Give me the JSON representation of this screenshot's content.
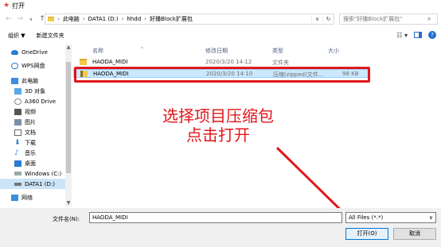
{
  "window": {
    "title": "打开"
  },
  "address": {
    "crumbs": [
      "此电脑",
      "DATA1 (D:)",
      "hhdd",
      "好播Block扩展包"
    ],
    "search_placeholder": "搜索\"好播Block扩展包\""
  },
  "toolbar": {
    "organize": "组织 ▼",
    "new_folder": "新建文件夹"
  },
  "sidebar": {
    "items": [
      {
        "label": "OneDrive",
        "icon": "cloud-icon"
      },
      {
        "label": "WPS网盘",
        "icon": "wps-cloud-icon"
      },
      {
        "label": "此电脑",
        "icon": "computer-icon"
      },
      {
        "label": "3D 对象",
        "icon": "3d-objects-icon"
      },
      {
        "label": "A360 Drive",
        "icon": "a360-icon"
      },
      {
        "label": "视频",
        "icon": "video-icon"
      },
      {
        "label": "图片",
        "icon": "pictures-icon"
      },
      {
        "label": "文档",
        "icon": "documents-icon"
      },
      {
        "label": "下载",
        "icon": "download-icon"
      },
      {
        "label": "音乐",
        "icon": "music-icon"
      },
      {
        "label": "桌面",
        "icon": "desktop-icon"
      },
      {
        "label": "Windows (C:)",
        "icon": "drive-c-icon"
      },
      {
        "label": "DATA1 (D:)",
        "icon": "drive-d-icon"
      },
      {
        "label": "网络",
        "icon": "network-icon"
      }
    ]
  },
  "columns": {
    "name": "名称",
    "date": "修改日期",
    "type": "类型",
    "size": "大小"
  },
  "files": [
    {
      "name": "HAODA_MIDI",
      "date": "2020/3/20 14:12",
      "type": "文件夹",
      "size": "",
      "icon": "folder-icon"
    },
    {
      "name": "HAODA_MIDI",
      "date": "2020/3/20 14:10",
      "type": "压缩(zipped)文件...",
      "size": "98 KB",
      "icon": "zip-icon"
    }
  ],
  "annotation": {
    "line1": "选择项目压缩包",
    "line2": "点击打开"
  },
  "bottom": {
    "filename_label": "文件名(N):",
    "filename_value": "HAODA_MIDI",
    "filetype": "All Files (*.*)",
    "open": "打开(O)",
    "cancel": "取消"
  },
  "colors": {
    "accent": "#0078d7",
    "annotation_red": "#e0171b",
    "selection": "#cce8ff"
  }
}
